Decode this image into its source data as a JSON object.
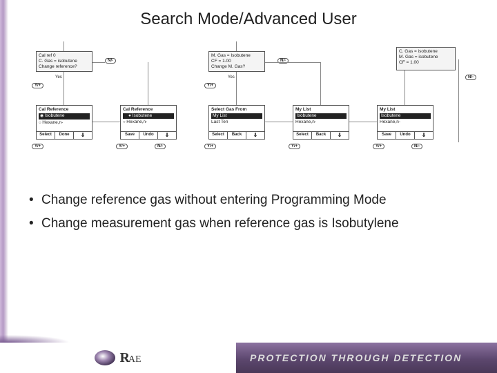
{
  "title": "Search Mode/Advanced User",
  "diagram": {
    "col1_top": {
      "l1": "Cal ref 0",
      "l2": "C. Gas = isobutene",
      "l3": "Change reference?"
    },
    "yes": "Yes",
    "n": "N/-",
    "yplus": "Y/+",
    "cal_ref": "Cal Reference",
    "opt_iso": "Isobutene",
    "opt_hex": "Hexane,n-",
    "select": "Select",
    "done": "Done",
    "save": "Save",
    "undo": "Undo",
    "back": "Back",
    "col3_top": {
      "l1": "M. Gas = Isobutene",
      "l2": "CF = 1.00",
      "l3": "Change M. Gas?"
    },
    "select_gas": "Select Gas From",
    "mylist": "My List",
    "lastten": "Last Ten",
    "col5_top": {
      "l1": "C. Gas = isobutene",
      "l2": "M. Gas = isobutene",
      "l3": "CF = 1.00"
    }
  },
  "bullets": [
    "Change reference gas without entering Programming Mode",
    "Change measurement gas when reference gas is Isobutylene"
  ],
  "logo": {
    "text1": "R",
    "text2": "AE"
  },
  "tagline": "PROTECTION THROUGH DETECTION"
}
